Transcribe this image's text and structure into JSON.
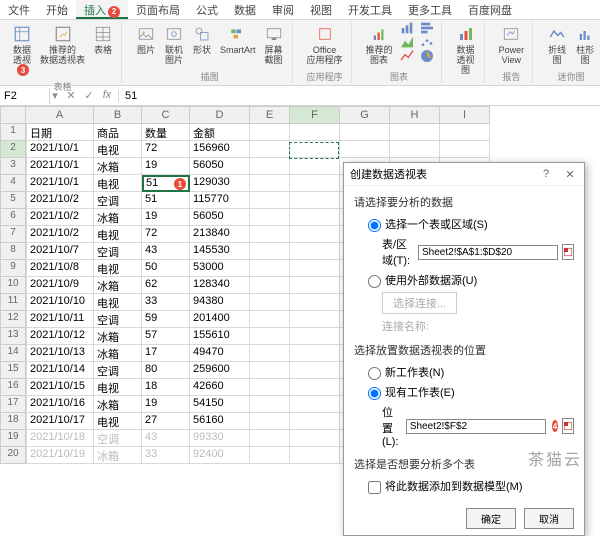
{
  "ribbon_tabs": [
    "文件",
    "开始",
    "插入",
    "页面布局",
    "公式",
    "数据",
    "审阅",
    "视图",
    "开发工具",
    "更多工具",
    "百度网盘"
  ],
  "active_tab_index": 2,
  "annotations": {
    "tab": "2",
    "pivot": "3",
    "cell": "1",
    "pos": "4"
  },
  "ribbon": {
    "group_tables": {
      "pivot": "数据\n透视",
      "rec": "推荐的\n数据透视表",
      "table": "表格",
      "name": "表格"
    },
    "group_illus": {
      "pic": "图片",
      "online": "联机图片",
      "shapes": "形状",
      "smartart": "SmartArt",
      "screenshot": "屏幕截图",
      "name": "插图"
    },
    "group_addins": {
      "office": "Office\n应用程序",
      "name": "应用程序"
    },
    "group_charts": {
      "rec": "推荐的\n图表",
      "name": "图表"
    },
    "group_pivotchart": {
      "btn": "数据透视图"
    },
    "group_reports": {
      "power": "Power\nView",
      "name": "报告"
    },
    "group_spark": {
      "line": "折线图",
      "col": "柱形图",
      "name": "迷你图"
    }
  },
  "formula_bar": {
    "name_box": "F2",
    "formula": "51"
  },
  "columns": [
    "A",
    "B",
    "C",
    "D",
    "E",
    "F",
    "G",
    "H",
    "I"
  ],
  "headers": {
    "a": "日期",
    "b": "商品",
    "c": "数量",
    "d": "金额"
  },
  "rows": [
    {
      "n": "1"
    },
    {
      "n": "2",
      "a": "2021/10/1",
      "b": "电视",
      "c": "72",
      "d": "156960"
    },
    {
      "n": "3",
      "a": "2021/10/1",
      "b": "冰箱",
      "c": "19",
      "d": "56050"
    },
    {
      "n": "4",
      "a": "2021/10/1",
      "b": "电视",
      "c": "51",
      "d": "129030"
    },
    {
      "n": "5",
      "a": "2021/10/2",
      "b": "空调",
      "c": "51",
      "d": "115770"
    },
    {
      "n": "6",
      "a": "2021/10/2",
      "b": "冰箱",
      "c": "19",
      "d": "56050"
    },
    {
      "n": "7",
      "a": "2021/10/2",
      "b": "电视",
      "c": "72",
      "d": "213840"
    },
    {
      "n": "8",
      "a": "2021/10/7",
      "b": "空调",
      "c": "43",
      "d": "145530"
    },
    {
      "n": "9",
      "a": "2021/10/8",
      "b": "电视",
      "c": "50",
      "d": "53000"
    },
    {
      "n": "10",
      "a": "2021/10/9",
      "b": "冰箱",
      "c": "62",
      "d": "128340"
    },
    {
      "n": "11",
      "a": "2021/10/10",
      "b": "电视",
      "c": "33",
      "d": "94380"
    },
    {
      "n": "12",
      "a": "2021/10/11",
      "b": "空调",
      "c": "59",
      "d": "201400"
    },
    {
      "n": "13",
      "a": "2021/10/12",
      "b": "冰箱",
      "c": "57",
      "d": "155610"
    },
    {
      "n": "14",
      "a": "2021/10/13",
      "b": "冰箱",
      "c": "17",
      "d": "49470"
    },
    {
      "n": "15",
      "a": "2021/10/14",
      "b": "空调",
      "c": "80",
      "d": "259600"
    },
    {
      "n": "16",
      "a": "2021/10/15",
      "b": "电视",
      "c": "18",
      "d": "42660"
    },
    {
      "n": "17",
      "a": "2021/10/16",
      "b": "冰箱",
      "c": "19",
      "d": "54150"
    },
    {
      "n": "18",
      "a": "2021/10/17",
      "b": "电视",
      "c": "27",
      "d": "56160"
    },
    {
      "n": "19",
      "a": "2021/10/18",
      "b": "空调",
      "c": "43",
      "d": "99330",
      "grey": true
    },
    {
      "n": "20",
      "a": "2021/10/19",
      "b": "冰箱",
      "c": "33",
      "d": "92400",
      "grey": true
    }
  ],
  "dialog": {
    "title": "创建数据透视表",
    "section1": "请选择要分析的数据",
    "opt_range": "选择一个表或区域(S)",
    "range_label": "表/区域(T):",
    "range_value": "Sheet2!$A$1:$D$20",
    "opt_external": "使用外部数据源(U)",
    "choose_conn": "选择连接...",
    "conn_name": "连接名称:",
    "section2": "选择放置数据透视表的位置",
    "opt_newsheet": "新工作表(N)",
    "opt_existing": "现有工作表(E)",
    "pos_label": "位置(L):",
    "pos_value": "Sheet2!$F$2",
    "section3": "选择是否想要分析多个表",
    "opt_multi": "将此数据添加到数据模型(M)",
    "ok": "确定",
    "cancel": "取消"
  },
  "watermark": "茶猫云"
}
